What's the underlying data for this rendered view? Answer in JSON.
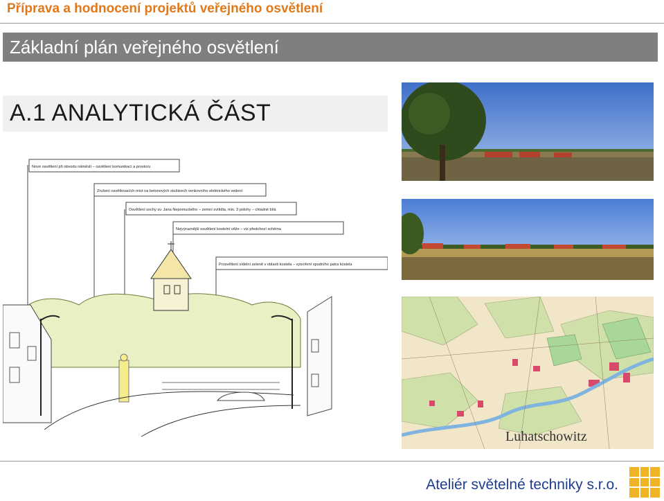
{
  "header": {
    "title": "Příprava a hodnocení projektů veřejného osvětlení",
    "subtitle": "Základní plán veřejného osvětlení"
  },
  "section": {
    "title": "A.1 ANALYTICKÁ ČÁST"
  },
  "sketch": {
    "annotations": [
      "Nové osvětlení při obvodu náměstí – osvětlení komunikací a prostoru",
      "Zrušení osvětlovacích míst na betonových stožárech venkovního elektrického vedení",
      "Osvětlení sochy sv. Jana Nepomuckého – zemní svítidla, min. 3 polohy – chladně bílá",
      "Nejvýraznější osvětlení kostelní věže – viz předchozí schéma",
      "Prosvětlení sídelní zeleně v oblasti kostela – vytvoření spodního patra kostela"
    ]
  },
  "map": {
    "label": "Luhatschowitz"
  },
  "footer": {
    "company": "Ateliér světelné techniky s.r.o."
  },
  "colors": {
    "header_accent": "#e0791c",
    "subtitle_bar": "#7f7f7f",
    "footer_text": "#1d3d8e",
    "logo": "#f0b323"
  }
}
